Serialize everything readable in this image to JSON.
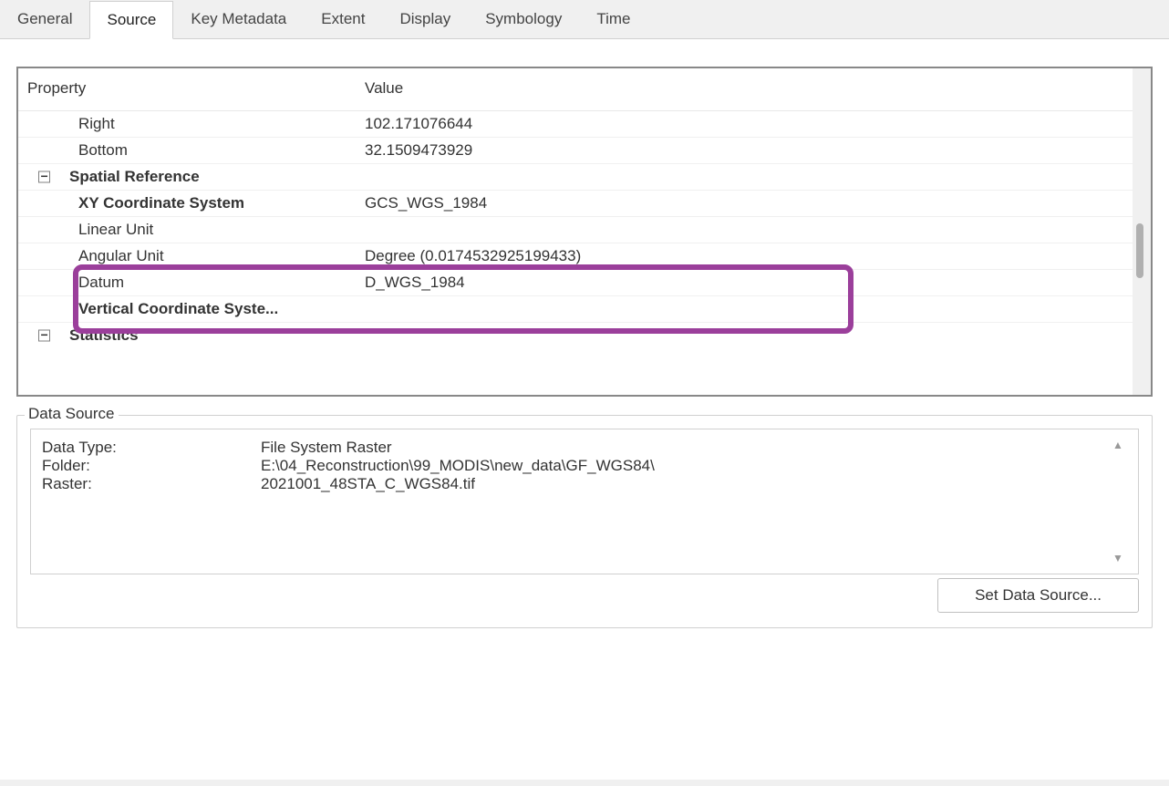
{
  "tabs": {
    "general": "General",
    "source": "Source",
    "key_metadata": "Key Metadata",
    "extent": "Extent",
    "display": "Display",
    "symbology": "Symbology",
    "time": "Time"
  },
  "property_grid": {
    "headers": {
      "property": "Property",
      "value": "Value"
    },
    "rows": {
      "right": {
        "label": "Right",
        "value": "102.171076644"
      },
      "bottom": {
        "label": "Bottom",
        "value": "32.1509473929"
      },
      "spatial_reference": {
        "label": "Spatial Reference"
      },
      "xy_cs": {
        "label": "XY Coordinate System",
        "value": "GCS_WGS_1984"
      },
      "linear_unit": {
        "label": "Linear Unit",
        "value": ""
      },
      "angular_unit": {
        "label": "Angular Unit",
        "value": "Degree (0.0174532925199433)"
      },
      "datum": {
        "label": "Datum",
        "value": "D_WGS_1984"
      },
      "vertical_cs": {
        "label": "Vertical Coordinate Syste...",
        "value": ""
      },
      "statistics": {
        "label": "Statistics"
      }
    }
  },
  "data_source": {
    "legend": "Data Source",
    "data_type": {
      "label": "Data Type:",
      "value": "File System Raster"
    },
    "folder": {
      "label": "Folder:",
      "value": "E:\\04_Reconstruction\\99_MODIS\\new_data\\GF_WGS84\\"
    },
    "raster": {
      "label": "Raster:",
      "value": "2021001_48STA_C_WGS84.tif"
    },
    "button": "Set Data Source..."
  },
  "icons": {
    "minus": "−",
    "up": "▲",
    "down": "▼"
  }
}
